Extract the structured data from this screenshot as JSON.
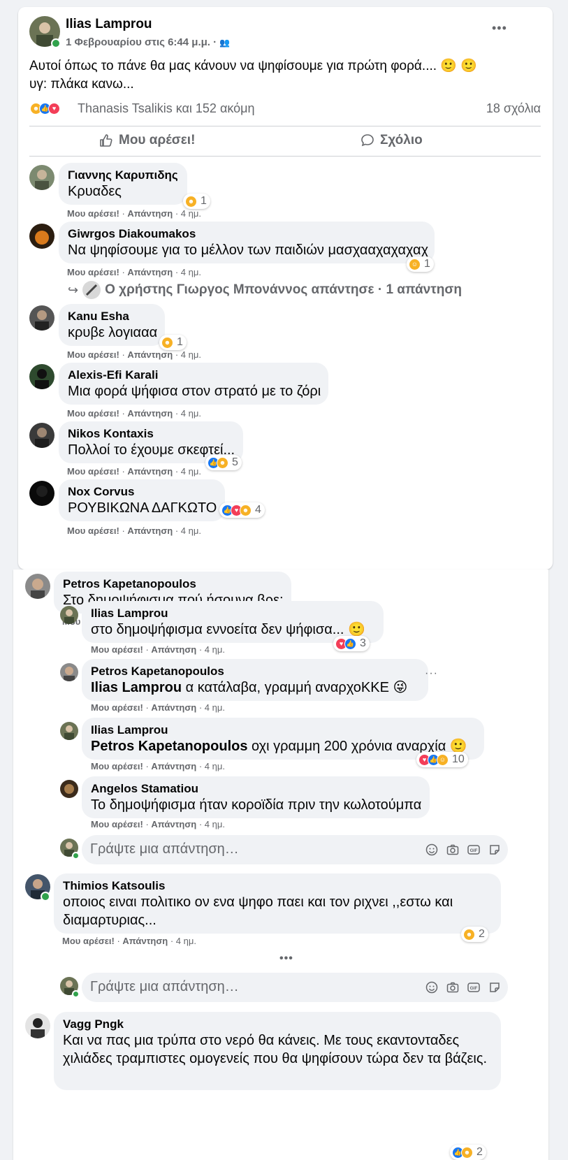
{
  "post": {
    "author": "Ilias Lamprou",
    "timestamp": "1 Φεβρουαρίου στις 6:44 μ.μ.",
    "audience_icon": "friends-icon",
    "more_icon": "•••",
    "text_line1": "Αυτοί όπως το πάνε θα μας κάνουν να ψηφίσουμε για πρώτη φορά.... 🙂 🙂",
    "text_line2": "υγ: πλάκα κανω...",
    "reactions_summary": "Thanasis Tsalikis και 152 ακόμη",
    "comments_count": "18 σχόλια",
    "like_button": "Μου αρέσει!",
    "comment_button": "Σχόλιο"
  },
  "meta_labels": {
    "like": "Μου αρέσει!",
    "reply": "Απάντηση",
    "time": "4 ημ.",
    "sep": "·"
  },
  "comments": [
    {
      "name": "Γιαννης Καρυπιδης",
      "text": "Κρυαδες",
      "reaction_count": "1"
    },
    {
      "name": "Giwrgos Diakoumakos",
      "text": "Να ψηφίσουμε για το μέλλον των παιδιών μασχααχαχαχαχ",
      "reaction_count": "1"
    },
    {
      "name": "Kanu Esha",
      "text": "κρυβε λογιααα",
      "reaction_count": "1"
    },
    {
      "name": "Alexis-Efi Karali",
      "text": "Μια φορά ψήφισα στον στρατό με το ζόρι"
    },
    {
      "name": "Nikos Kontaxis",
      "text": "Πολλοί το έχουμε σκεφτεί...",
      "reaction_count": "5"
    },
    {
      "name": "Nox Corvus",
      "text": "ΡΟΥΒΙΚΩΝΑ ΔΑΓΚΩΤΟ",
      "reaction_count": "4"
    }
  ],
  "replies_link": "Ο χρήστης Γιωργος Μπονάννος απάντησε · 1 απάντηση",
  "thread": {
    "petros": {
      "name": "Petros Kapetanopoulos",
      "text": "Στο δημοψήφισμα πού ήσουνα βρε;"
    },
    "replies": [
      {
        "name": "Ilias Lamprou",
        "text": "στο δημοψήφισμα εννοείτα δεν ψήφισα... 🙂",
        "reaction_count": "3"
      },
      {
        "name": "Petros Kapetanopoulos",
        "mention": "Ilias Lamprou",
        "text": " α κατάλαβα, γραμμή αναρχοΚΚΕ 😜"
      },
      {
        "name": "Ilias Lamprou",
        "mention": "Petros Kapetanopoulos",
        "text": " οχι γραμμη 200 χρόνια αναρχία 🙂",
        "reaction_count": "10"
      },
      {
        "name": "Angelos Stamatiou",
        "text": "Το δημοψήφισμα ήταν κοροϊδία πριν την κωλοτούμπα"
      }
    ],
    "reply_placeholder": "Γράψτε μια απάντηση…"
  },
  "thimios": {
    "name": "Thimios Katsoulis",
    "text": "οποιος ειναι πολιτικο ον ενα ψηφο παει και τον ριχνει ,,εστω και διαμαρτυριας...",
    "reaction_count": "2",
    "more_replies": "•••",
    "reply_placeholder": "Γράψτε μια απάντηση…"
  },
  "vagg": {
    "name": "Vagg Pngk",
    "text": "Και να πας μια τρύπα στο νερό θα κάνεις. Με τους εκαντονταδες χιλιάδες τραμπιστες ομογενείς που θα ψηφίσουν τώρα δεν τα βάζεις.",
    "reaction_count": "2"
  },
  "colors": {
    "like": "#1877f2",
    "love": "#f33e58",
    "haha": "#f7b125",
    "secondary_text": "#65676b",
    "bubble": "#f0f2f5"
  }
}
